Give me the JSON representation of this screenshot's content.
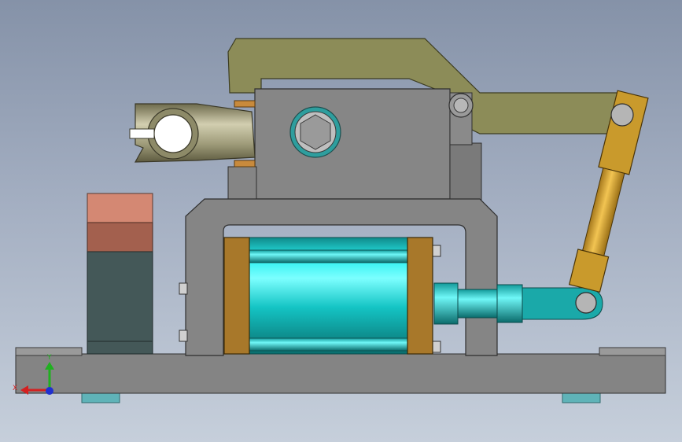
{
  "viewport": {
    "background_top": "#8592a8",
    "background_bottom": "#c6cfdb"
  },
  "colors": {
    "body_gray": "#858585",
    "body_edge": "#3a3a3a",
    "clamp_arm_olive": "#8c8c58",
    "link_gold": "#c99a2c",
    "cylinder_cyan": "#1fd6d6",
    "end_cap_brown": "#a8782a",
    "block_salmon": "#d48873",
    "block_brown": "#a3604e",
    "block_slate": "#445858",
    "foot_teal": "#5fb3b8"
  },
  "triad": {
    "x_label": "X",
    "y_label": "Y",
    "x_color": "#d42020",
    "y_color": "#20b020",
    "z_color": "#2030d0"
  }
}
